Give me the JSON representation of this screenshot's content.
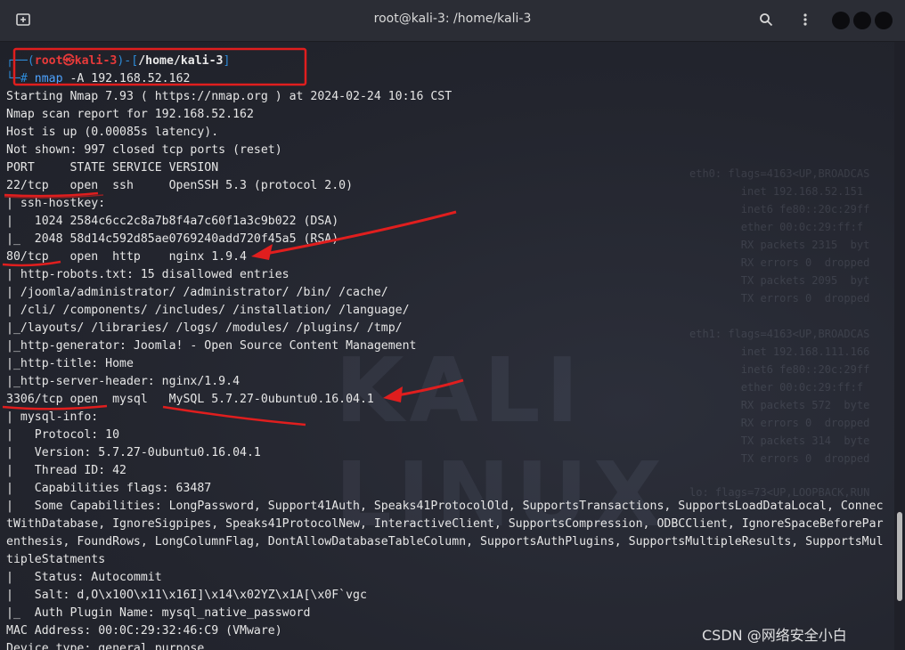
{
  "window": {
    "title": "root@kali-3: /home/kali-3",
    "icons": [
      "new-tab-icon",
      "search-icon",
      "menu-icon"
    ]
  },
  "prompt": {
    "top": "┌──(",
    "user": "root㉿kali-3",
    "mid": ")-[",
    "path": "/home/kali-3",
    "end": "]",
    "hash_prefix": "└─# ",
    "cmd_name": "nmap",
    "cmd_args": " -A 192.168.52.162"
  },
  "output": [
    "Starting Nmap 7.93 ( https://nmap.org ) at 2024-02-24 10:16 CST",
    "Nmap scan report for 192.168.52.162",
    "Host is up (0.00085s latency).",
    "Not shown: 997 closed tcp ports (reset)",
    "PORT     STATE SERVICE VERSION",
    "22/tcp   open  ssh     OpenSSH 5.3 (protocol 2.0)",
    "| ssh-hostkey: ",
    "|   1024 2584c6cc2c8a7b8f4a7c60f1a3c9b022 (DSA)",
    "|_  2048 58d14c592d85ae0769240add720f45a5 (RSA)",
    "80/tcp   open  http    nginx 1.9.4",
    "| http-robots.txt: 15 disallowed entries ",
    "| /joomla/administrator/ /administrator/ /bin/ /cache/ ",
    "| /cli/ /components/ /includes/ /installation/ /language/ ",
    "|_/layouts/ /libraries/ /logs/ /modules/ /plugins/ /tmp/",
    "|_http-generator: Joomla! - Open Source Content Management",
    "|_http-title: Home",
    "|_http-server-header: nginx/1.9.4",
    "3306/tcp open  mysql   MySQL 5.7.27-0ubuntu0.16.04.1",
    "| mysql-info: ",
    "|   Protocol: 10",
    "|   Version: 5.7.27-0ubuntu0.16.04.1",
    "|   Thread ID: 42",
    "|   Capabilities flags: 63487",
    "|   Some Capabilities: LongPassword, Support41Auth, Speaks41ProtocolOld, SupportsTransactions, SupportsLoadDataLocal, Connec",
    "tWithDatabase, IgnoreSigpipes, Speaks41ProtocolNew, InteractiveClient, SupportsCompression, ODBCClient, IgnoreSpaceBeforePar",
    "enthesis, FoundRows, LongColumnFlag, DontAllowDatabaseTableColumn, SupportsAuthPlugins, SupportsMultipleResults, SupportsMul",
    "tipleStatments",
    "|   Status: Autocommit",
    "|   Salt: d,O\\x10O\\x11\\x16I]\\x14\\x02YZ\\x1A[\\x0F`vgc",
    "|_  Auth Plugin Name: mysql_native_password",
    "MAC Address: 00:0C:29:32:46:C9 (VMware)",
    "Device type: general purpose"
  ],
  "background_text": {
    "block1": "eth0: flags=4163<UP,BROADCAS\n        inet 192.168.52.151\n        inet6 fe80::20c:29ff\n        ether 00:0c:29:ff:f\n        RX packets 2315  byt\n        RX errors 0  dropped\n        TX packets 2095  byt\n        TX errors 0  dropped",
    "block2": "eth1: flags=4163<UP,BROADCAS\n        inet 192.168.111.166\n        inet6 fe80::20c:29ff\n        ether 00:0c:29:ff:f\n        RX packets 572  byte\n        RX errors 0  dropped\n        TX packets 314  byte\n        TX errors 0  dropped",
    "block3": "lo: flags=73<UP,LOOPBACK,RUN",
    "logo": "KALI LINUX"
  },
  "watermark": "CSDN @网络安全小白",
  "colors": {
    "background": "#23252e",
    "prompt_frame": "#2e8bd8",
    "prompt_user": "#e83a3a",
    "annotation": "#e01e1e"
  }
}
